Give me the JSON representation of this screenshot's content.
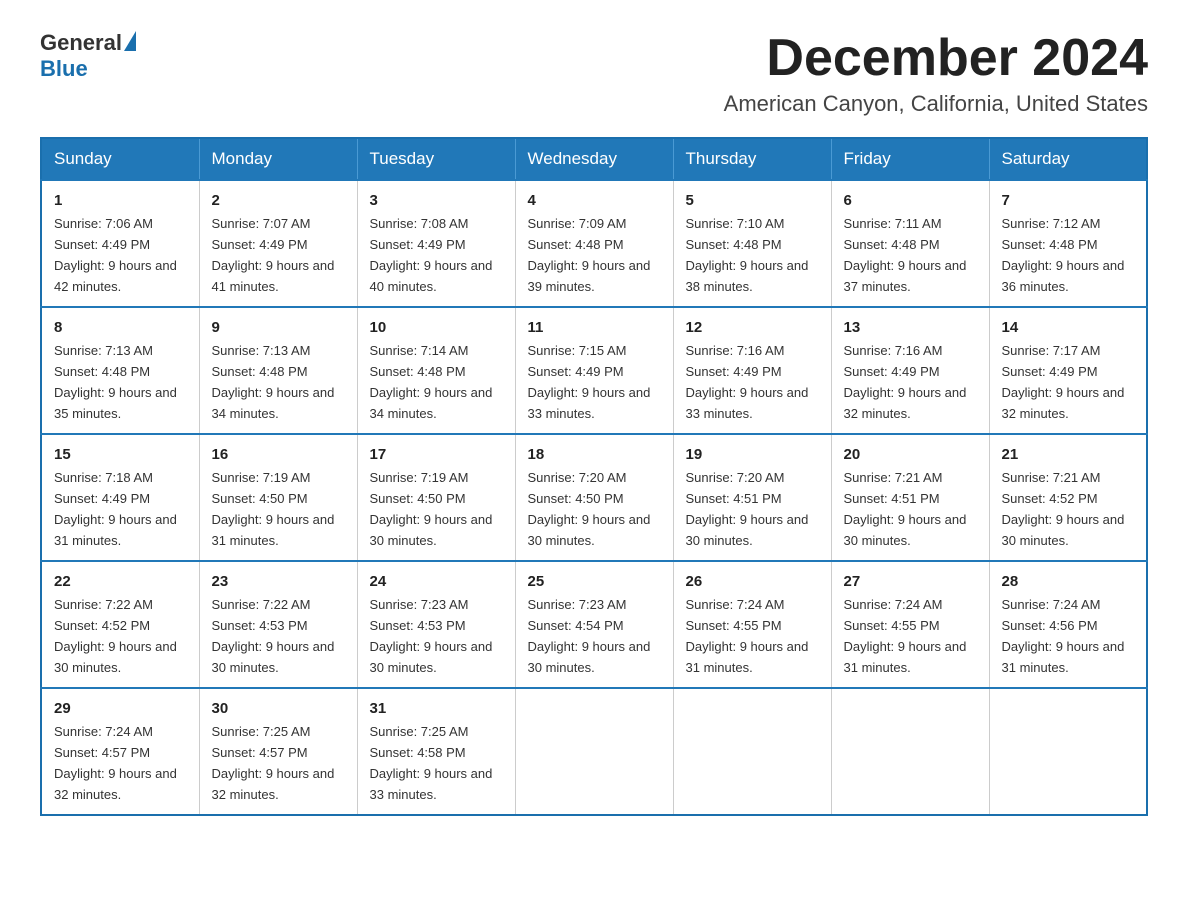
{
  "logo": {
    "general": "General",
    "blue": "Blue"
  },
  "header": {
    "month": "December 2024",
    "location": "American Canyon, California, United States"
  },
  "weekdays": [
    "Sunday",
    "Monday",
    "Tuesday",
    "Wednesday",
    "Thursday",
    "Friday",
    "Saturday"
  ],
  "weeks": [
    [
      {
        "day": "1",
        "sunrise": "7:06 AM",
        "sunset": "4:49 PM",
        "daylight": "9 hours and 42 minutes."
      },
      {
        "day": "2",
        "sunrise": "7:07 AM",
        "sunset": "4:49 PM",
        "daylight": "9 hours and 41 minutes."
      },
      {
        "day": "3",
        "sunrise": "7:08 AM",
        "sunset": "4:49 PM",
        "daylight": "9 hours and 40 minutes."
      },
      {
        "day": "4",
        "sunrise": "7:09 AM",
        "sunset": "4:48 PM",
        "daylight": "9 hours and 39 minutes."
      },
      {
        "day": "5",
        "sunrise": "7:10 AM",
        "sunset": "4:48 PM",
        "daylight": "9 hours and 38 minutes."
      },
      {
        "day": "6",
        "sunrise": "7:11 AM",
        "sunset": "4:48 PM",
        "daylight": "9 hours and 37 minutes."
      },
      {
        "day": "7",
        "sunrise": "7:12 AM",
        "sunset": "4:48 PM",
        "daylight": "9 hours and 36 minutes."
      }
    ],
    [
      {
        "day": "8",
        "sunrise": "7:13 AM",
        "sunset": "4:48 PM",
        "daylight": "9 hours and 35 minutes."
      },
      {
        "day": "9",
        "sunrise": "7:13 AM",
        "sunset": "4:48 PM",
        "daylight": "9 hours and 34 minutes."
      },
      {
        "day": "10",
        "sunrise": "7:14 AM",
        "sunset": "4:48 PM",
        "daylight": "9 hours and 34 minutes."
      },
      {
        "day": "11",
        "sunrise": "7:15 AM",
        "sunset": "4:49 PM",
        "daylight": "9 hours and 33 minutes."
      },
      {
        "day": "12",
        "sunrise": "7:16 AM",
        "sunset": "4:49 PM",
        "daylight": "9 hours and 33 minutes."
      },
      {
        "day": "13",
        "sunrise": "7:16 AM",
        "sunset": "4:49 PM",
        "daylight": "9 hours and 32 minutes."
      },
      {
        "day": "14",
        "sunrise": "7:17 AM",
        "sunset": "4:49 PM",
        "daylight": "9 hours and 32 minutes."
      }
    ],
    [
      {
        "day": "15",
        "sunrise": "7:18 AM",
        "sunset": "4:49 PM",
        "daylight": "9 hours and 31 minutes."
      },
      {
        "day": "16",
        "sunrise": "7:19 AM",
        "sunset": "4:50 PM",
        "daylight": "9 hours and 31 minutes."
      },
      {
        "day": "17",
        "sunrise": "7:19 AM",
        "sunset": "4:50 PM",
        "daylight": "9 hours and 30 minutes."
      },
      {
        "day": "18",
        "sunrise": "7:20 AM",
        "sunset": "4:50 PM",
        "daylight": "9 hours and 30 minutes."
      },
      {
        "day": "19",
        "sunrise": "7:20 AM",
        "sunset": "4:51 PM",
        "daylight": "9 hours and 30 minutes."
      },
      {
        "day": "20",
        "sunrise": "7:21 AM",
        "sunset": "4:51 PM",
        "daylight": "9 hours and 30 minutes."
      },
      {
        "day": "21",
        "sunrise": "7:21 AM",
        "sunset": "4:52 PM",
        "daylight": "9 hours and 30 minutes."
      }
    ],
    [
      {
        "day": "22",
        "sunrise": "7:22 AM",
        "sunset": "4:52 PM",
        "daylight": "9 hours and 30 minutes."
      },
      {
        "day": "23",
        "sunrise": "7:22 AM",
        "sunset": "4:53 PM",
        "daylight": "9 hours and 30 minutes."
      },
      {
        "day": "24",
        "sunrise": "7:23 AM",
        "sunset": "4:53 PM",
        "daylight": "9 hours and 30 minutes."
      },
      {
        "day": "25",
        "sunrise": "7:23 AM",
        "sunset": "4:54 PM",
        "daylight": "9 hours and 30 minutes."
      },
      {
        "day": "26",
        "sunrise": "7:24 AM",
        "sunset": "4:55 PM",
        "daylight": "9 hours and 31 minutes."
      },
      {
        "day": "27",
        "sunrise": "7:24 AM",
        "sunset": "4:55 PM",
        "daylight": "9 hours and 31 minutes."
      },
      {
        "day": "28",
        "sunrise": "7:24 AM",
        "sunset": "4:56 PM",
        "daylight": "9 hours and 31 minutes."
      }
    ],
    [
      {
        "day": "29",
        "sunrise": "7:24 AM",
        "sunset": "4:57 PM",
        "daylight": "9 hours and 32 minutes."
      },
      {
        "day": "30",
        "sunrise": "7:25 AM",
        "sunset": "4:57 PM",
        "daylight": "9 hours and 32 minutes."
      },
      {
        "day": "31",
        "sunrise": "7:25 AM",
        "sunset": "4:58 PM",
        "daylight": "9 hours and 33 minutes."
      },
      null,
      null,
      null,
      null
    ]
  ]
}
